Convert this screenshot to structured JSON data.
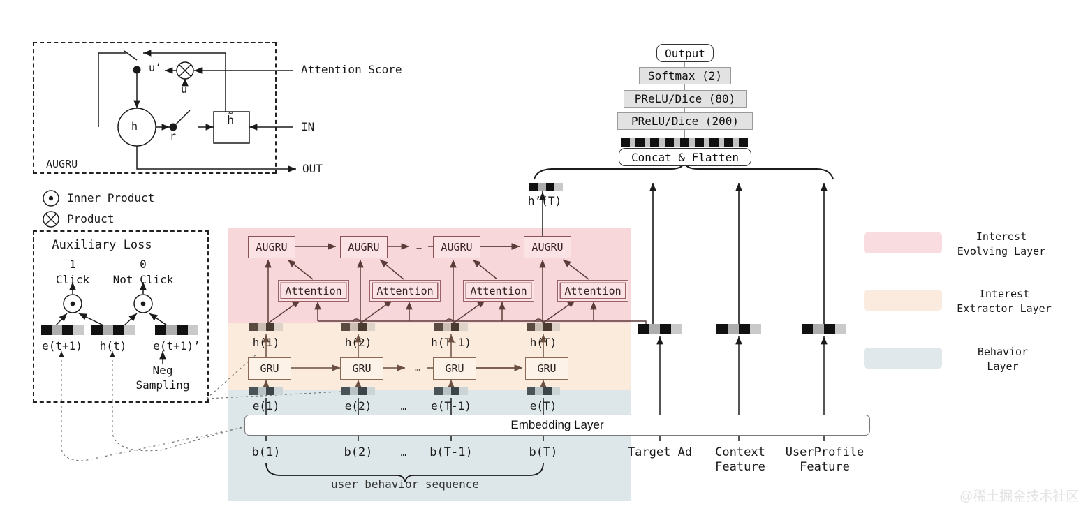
{
  "augru_cell": {
    "title": "AUGRU",
    "nodes": {
      "h": "h",
      "h_tilde": "h̃",
      "u": "u",
      "u_prime": "u’",
      "r": "r"
    },
    "inputs": {
      "attention_score": "Attention Score",
      "in": "IN"
    },
    "outputs": {
      "out": "OUT"
    }
  },
  "symbol_legend": [
    {
      "icon": "inner-product-icon",
      "label": "Inner Product"
    },
    {
      "icon": "product-icon",
      "label": "Product"
    }
  ],
  "auxiliary_loss": {
    "title": "Auxiliary Loss",
    "pos_value": "1",
    "pos_label": "Click",
    "neg_value": "0",
    "neg_label": "Not Click",
    "vectors": [
      {
        "name": "e(t+1)"
      },
      {
        "name": "h(t)"
      },
      {
        "name": "e(t+1)’"
      }
    ],
    "neg_sampling": "Neg\nSampling"
  },
  "mlp_stack": {
    "output": "Output",
    "layers": [
      "Softmax (2)",
      "PReLU/Dice (80)",
      "PReLU/Dice (200)"
    ],
    "concat": "Concat & Flatten"
  },
  "interest_evolving": {
    "cells": [
      "AUGRU",
      "AUGRU",
      "AUGRU",
      "AUGRU"
    ],
    "ellipsis": "…",
    "attentions": [
      "Attention",
      "Attention",
      "Attention",
      "Attention"
    ],
    "output_vector_label": "h’(T)"
  },
  "interest_extractor": {
    "cells": [
      "GRU",
      "GRU",
      "GRU",
      "GRU"
    ],
    "ellipsis": "…",
    "hidden_labels": [
      "h(1)",
      "h(2)",
      "h(T-1)",
      "h(T)"
    ]
  },
  "behavior_layer": {
    "embedding_labels": [
      "e(1)",
      "e(2)",
      "e(T-1)",
      "e(T)"
    ],
    "embedding_ellipsis": "…",
    "embedding_layer_title": "Embedding Layer",
    "behavior_labels": [
      "b(1)",
      "b(2)",
      "b(T-1)",
      "b(T)"
    ],
    "behavior_ellipsis": "…",
    "brace_caption": "user behavior sequence"
  },
  "side_features": [
    {
      "label": "Target Ad"
    },
    {
      "label": "Context\nFeature"
    },
    {
      "label": "UserProfile\nFeature"
    }
  ],
  "layer_legend": [
    {
      "color": "#f9dcdf",
      "label": "Interest\nEvolving Layer"
    },
    {
      "color": "#fbeade",
      "label": "Interest\nExtractor Layer"
    },
    {
      "color": "#e0e8eb",
      "label": "Behavior\nLayer"
    }
  ],
  "watermark": "@稀土掘金技术社区",
  "colors": {
    "interest_evolving_band": "#f7d7da",
    "interest_extractor_band": "#fbebdd",
    "behavior_band": "#dde6e9",
    "augru_border": "#8a5358",
    "gru_border": "#8a6a55",
    "mlp_fill": "#e2e2e2",
    "stroke": "#1a1a1a"
  }
}
